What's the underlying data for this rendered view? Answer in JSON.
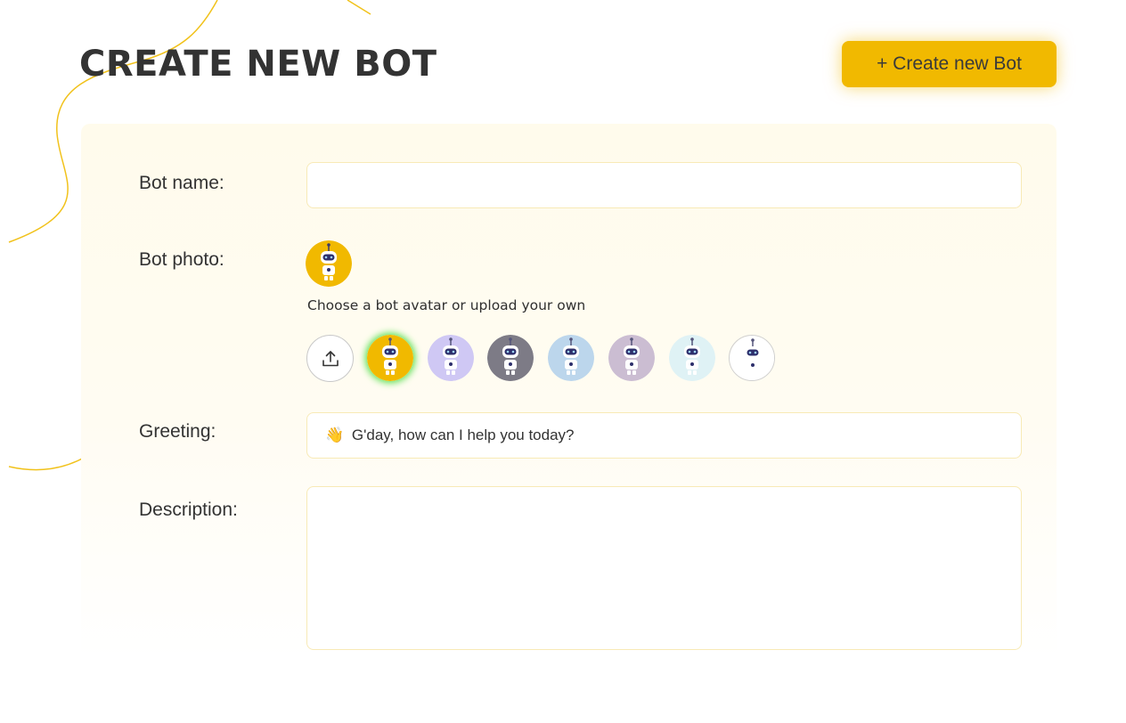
{
  "header": {
    "title": "CREATE NEW BOT",
    "create_button_label": "+ Create new Bot"
  },
  "form": {
    "bot_name": {
      "label": "Bot name:",
      "value": ""
    },
    "bot_photo": {
      "label": "Bot photo:",
      "hint": "Choose a bot avatar or upload your own",
      "avatars": [
        {
          "name": "yellow-robot",
          "bg": "#f1b900",
          "selected": true
        },
        {
          "name": "lavender-robot",
          "bg": "#cfc8f4",
          "selected": false
        },
        {
          "name": "gray-robot",
          "bg": "#7d7b86",
          "selected": false
        },
        {
          "name": "blue-robot",
          "bg": "#bcd6ec",
          "selected": false
        },
        {
          "name": "mauve-robot",
          "bg": "#cbbdd2",
          "selected": false
        },
        {
          "name": "mint-robot",
          "bg": "#dff2f5",
          "selected": false
        },
        {
          "name": "white-robot",
          "bg": "#ffffff",
          "selected": false
        }
      ]
    },
    "greeting": {
      "label": "Greeting:",
      "emoji": "👋",
      "value": "G'day, how can I help you today?"
    },
    "description": {
      "label": "Description:",
      "value": ""
    }
  },
  "colors": {
    "accent": "#f1b900",
    "field_border": "#f8eab6",
    "panel_bg": "#fffbec",
    "selected_glow": "#5be050",
    "decorative_line": "#f1c21b"
  }
}
